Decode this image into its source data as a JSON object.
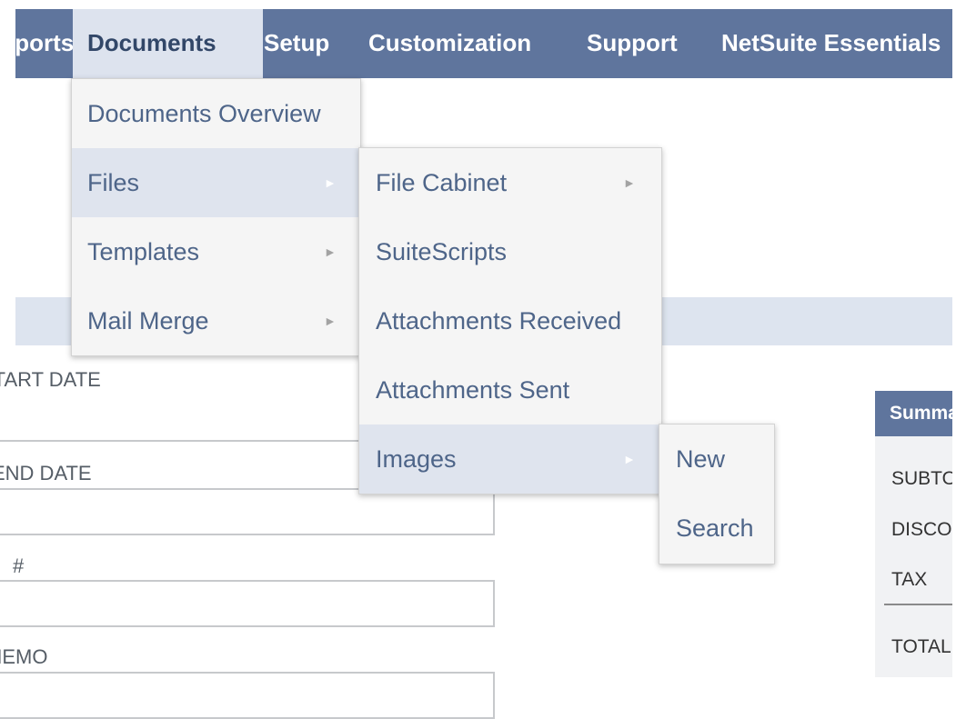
{
  "nav": {
    "items": [
      {
        "id": "reports",
        "label": "Reports"
      },
      {
        "id": "documents",
        "label": "Documents"
      },
      {
        "id": "setup",
        "label": "Setup"
      },
      {
        "id": "customization",
        "label": "Customization"
      },
      {
        "id": "support",
        "label": "Support"
      },
      {
        "id": "essentials",
        "label": "NetSuite Essentials"
      }
    ]
  },
  "menus": {
    "documents": [
      {
        "label": "Documents Overview",
        "has_submenu": false
      },
      {
        "label": "Files",
        "has_submenu": true,
        "highlighted": true
      },
      {
        "label": "Templates",
        "has_submenu": true
      },
      {
        "label": "Mail Merge",
        "has_submenu": true
      }
    ],
    "files": [
      {
        "label": "File Cabinet",
        "has_submenu": true
      },
      {
        "label": "SuiteScripts",
        "has_submenu": false
      },
      {
        "label": "Attachments Received",
        "has_submenu": false
      },
      {
        "label": "Attachments Sent",
        "has_submenu": false
      },
      {
        "label": "Images",
        "has_submenu": true,
        "highlighted": true
      }
    ],
    "images": [
      {
        "label": "New"
      },
      {
        "label": "Search"
      }
    ],
    "arrow_glyph": "►"
  },
  "form": {
    "labels": [
      "START DATE",
      "END DATE",
      "#",
      "MEMO"
    ]
  },
  "summary": {
    "title": "Summary",
    "rows": [
      "SUBTOTAL",
      "DISCOUNT",
      "TAX",
      "TOTAL"
    ]
  },
  "colors": {
    "nav_bg": "#5f759d",
    "nav_active_bg": "#dde3ee",
    "menu_bg": "#f5f5f5",
    "menu_highlight": "#dfe4ee",
    "menu_text": "#4e6589"
  }
}
